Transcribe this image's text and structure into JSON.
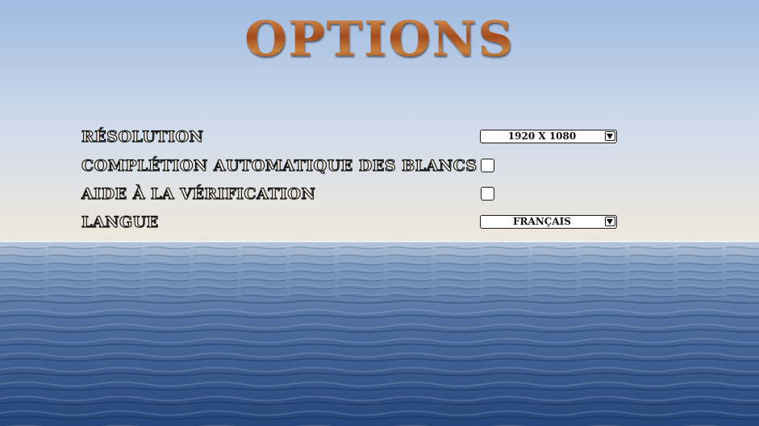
{
  "title": "OPTIONS",
  "options": {
    "resolution": {
      "label": "Résolution",
      "value": "1920 x 1080"
    },
    "autocomplete": {
      "label": "Complétion automatique des blancs",
      "checked": false
    },
    "verification": {
      "label": "Aide à la vérification",
      "checked": false
    },
    "language": {
      "label": "Langue",
      "value": "Français"
    }
  },
  "colors": {
    "sky_top": "#9fbbe0",
    "sky_horizon": "#efe8dc",
    "sea_light": "#7f9cc0",
    "sea_dark": "#24467a",
    "label_fill": "#f4ecdc",
    "label_outline": "#161616"
  },
  "icons": [
    "dropdown-arrow-icon"
  ]
}
